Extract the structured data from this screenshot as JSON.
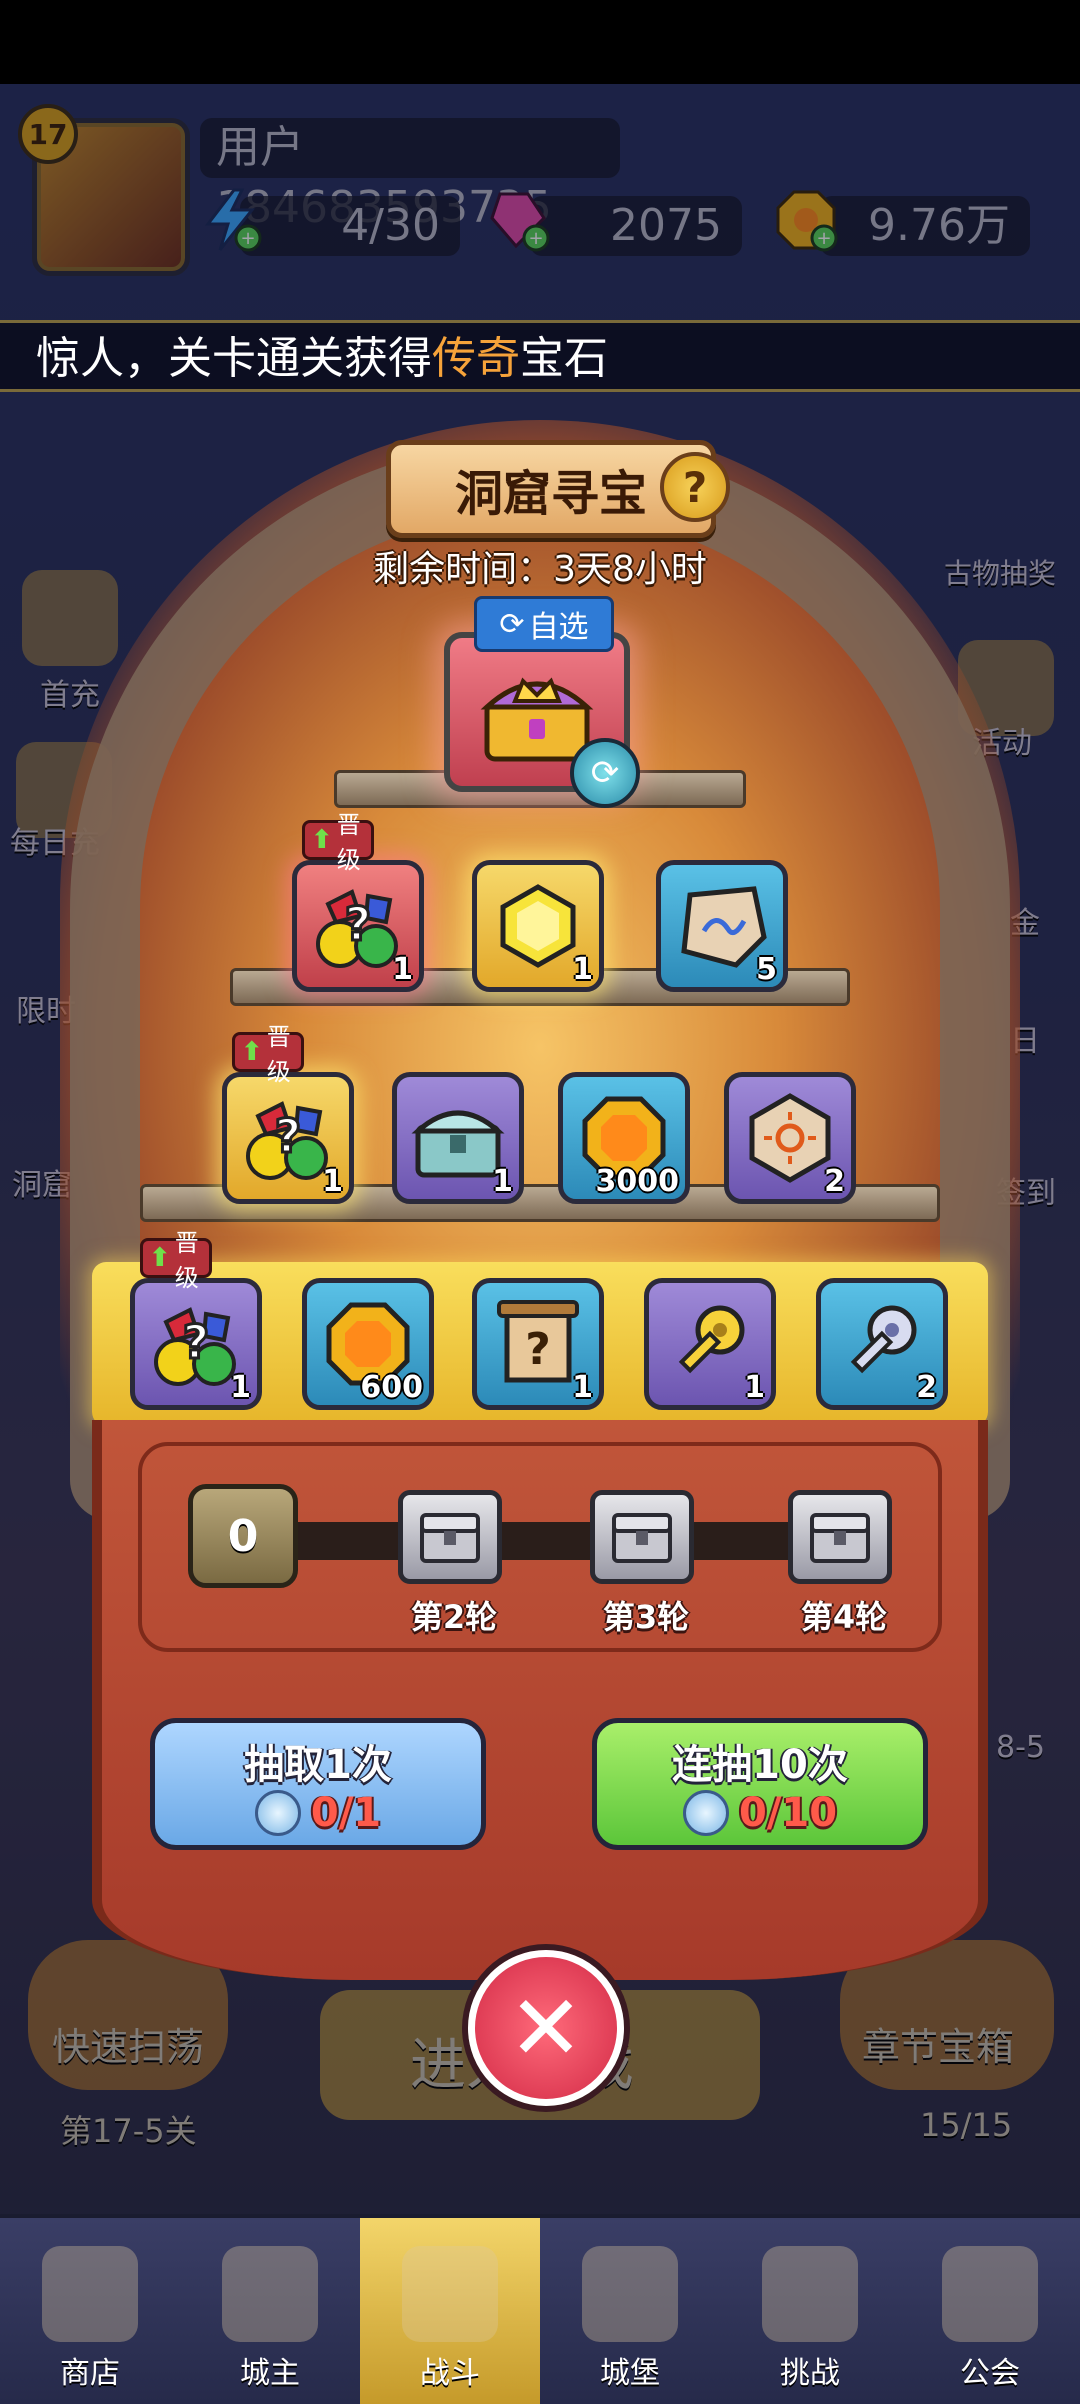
{
  "player": {
    "level": "17",
    "username": "用户184683593735",
    "stamina": "4/30",
    "gems": "2075",
    "gold": "9.76万"
  },
  "marquee": {
    "prefix": "惊人，关卡通关获得",
    "highlight": "传奇",
    "suffix": "宝石"
  },
  "side_left": [
    "首充",
    "每日充",
    "限时",
    "洞窟"
  ],
  "side_right": [
    "古物抽奖",
    "活动",
    "金",
    "日",
    "签到"
  ],
  "modal": {
    "title": "洞窟寻宝",
    "help": "?",
    "timer": "剩余时间：3天8小时",
    "auto_select": "自选",
    "upgrade_tag": "晋级",
    "tier1": [
      {
        "icon": "mystery-gem-icon",
        "qty": "1",
        "style": "red",
        "tag": true
      },
      {
        "icon": "yellow-gem-icon",
        "qty": "1",
        "style": "gold"
      },
      {
        "icon": "rune-stone-icon",
        "qty": "5",
        "style": "blue"
      }
    ],
    "tier2": [
      {
        "icon": "mystery-gem-icon",
        "qty": "1",
        "style": "gold",
        "tag": true
      },
      {
        "icon": "silver-chest-icon",
        "qty": "1",
        "style": "purple"
      },
      {
        "icon": "gold-coin-icon",
        "qty": "3000",
        "style": "blue"
      },
      {
        "icon": "sun-emblem-icon",
        "qty": "2",
        "style": "purple"
      }
    ],
    "tier3": [
      {
        "icon": "mystery-gem-icon",
        "qty": "1",
        "style": "purple",
        "tag": true
      },
      {
        "icon": "gold-coin-icon",
        "qty": "600",
        "style": "blue"
      },
      {
        "icon": "mystery-scroll-icon",
        "qty": "1",
        "style": "blue"
      },
      {
        "icon": "gold-key-icon",
        "qty": "1",
        "style": "purple"
      },
      {
        "icon": "silver-key-icon",
        "qty": "2",
        "style": "blue"
      }
    ],
    "progress_value": "0",
    "rounds": [
      "第2轮",
      "第3轮",
      "第4轮"
    ],
    "draw_once": {
      "label": "抽取1次",
      "cost": "0/1"
    },
    "draw_ten": {
      "label": "连抽10次",
      "cost": "0/10"
    }
  },
  "background": {
    "quick_sweep": "快速扫荡",
    "quick_sweep_stage": "第17-5关",
    "enter_game": "进入游戏",
    "chapter_chest": "章节宝箱",
    "chapter_progress": "15/15",
    "stage_label": "8-5"
  },
  "nav": [
    {
      "label": "商店",
      "icon": "shop-icon"
    },
    {
      "label": "城主",
      "icon": "crown-icon"
    },
    {
      "label": "战斗",
      "icon": "crossed-swords-icon"
    },
    {
      "label": "城堡",
      "icon": "castle-icon"
    },
    {
      "label": "挑战",
      "icon": "demon-icon"
    },
    {
      "label": "公会",
      "icon": "guild-flag-icon"
    }
  ]
}
